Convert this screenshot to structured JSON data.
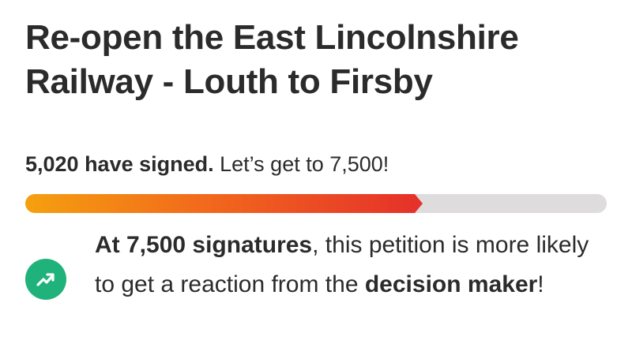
{
  "petition": {
    "title": "Re-open the East Lincolnshire Railway - Louth to Firsby"
  },
  "progress": {
    "signed_count_text": "5,020 have signed.",
    "goal_text": " Let’s get to 7,500!",
    "signed": 5020,
    "goal": 7500,
    "fill_fraction": 0.6693,
    "colors": {
      "track": "#dedcdc",
      "fill_start": "#f5a00f",
      "fill_end": "#e5322a"
    }
  },
  "milestone": {
    "icon": "trending-up-icon",
    "icon_color": "#1fb27a",
    "bold_lead": "At 7,500 signatures",
    "middle_text": ", this petition is more likely to get a reaction from the ",
    "bold_tail": "decision maker",
    "end_text": "!"
  }
}
